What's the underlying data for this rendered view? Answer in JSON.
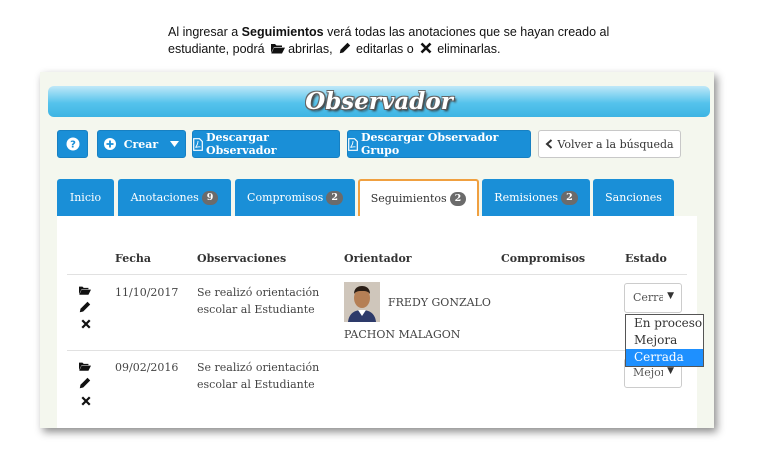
{
  "instructions": {
    "prefix": "Al ingresar a ",
    "bold": "Seguimientos",
    "middle": " verá todas las anotaciones que se hayan creado al estudiante, podrá ",
    "open_text": "abrirlas,",
    "edit_text": "editarlas o",
    "delete_text": "eliminarlas."
  },
  "banner": {
    "title": "Observador"
  },
  "toolbar": {
    "crear": "Crear",
    "descargar": "Descargar Observador",
    "descargar_grupo": "Descargar Observador Grupo",
    "volver": "Volver a la búsqueda"
  },
  "tabs": [
    {
      "label": "Inicio",
      "badge": ""
    },
    {
      "label": "Anotaciones",
      "badge": "9"
    },
    {
      "label": "Compromisos",
      "badge": "2"
    },
    {
      "label": "Seguimientos",
      "badge": "2"
    },
    {
      "label": "Remisiones",
      "badge": "2"
    },
    {
      "label": "Sanciones",
      "badge": ""
    }
  ],
  "table": {
    "headers": [
      "Fecha",
      "Observaciones",
      "Orientador",
      "Compromisos",
      "Estado"
    ],
    "rows": [
      {
        "fecha": "11/10/2017",
        "obs_line1": "Se realizó orientación",
        "obs_line2": "escolar al Estudiante",
        "orientador_line1": "FREDY GONZALO",
        "orientador_line2": "PACHON MALAGON",
        "estado": "Cerrada"
      },
      {
        "fecha": "09/02/2016",
        "obs_line1": "Se realizó orientación",
        "obs_line2": "escolar al Estudiante",
        "estado": "Mejora"
      }
    ]
  },
  "dropdown": {
    "options": [
      "En proceso",
      "Mejora",
      "Cerrada"
    ],
    "selected": "Cerrada"
  },
  "colors": {
    "primary": "#1a8fd7",
    "active_tab_border": "#f0a040",
    "highlight": "#1e90ff"
  }
}
